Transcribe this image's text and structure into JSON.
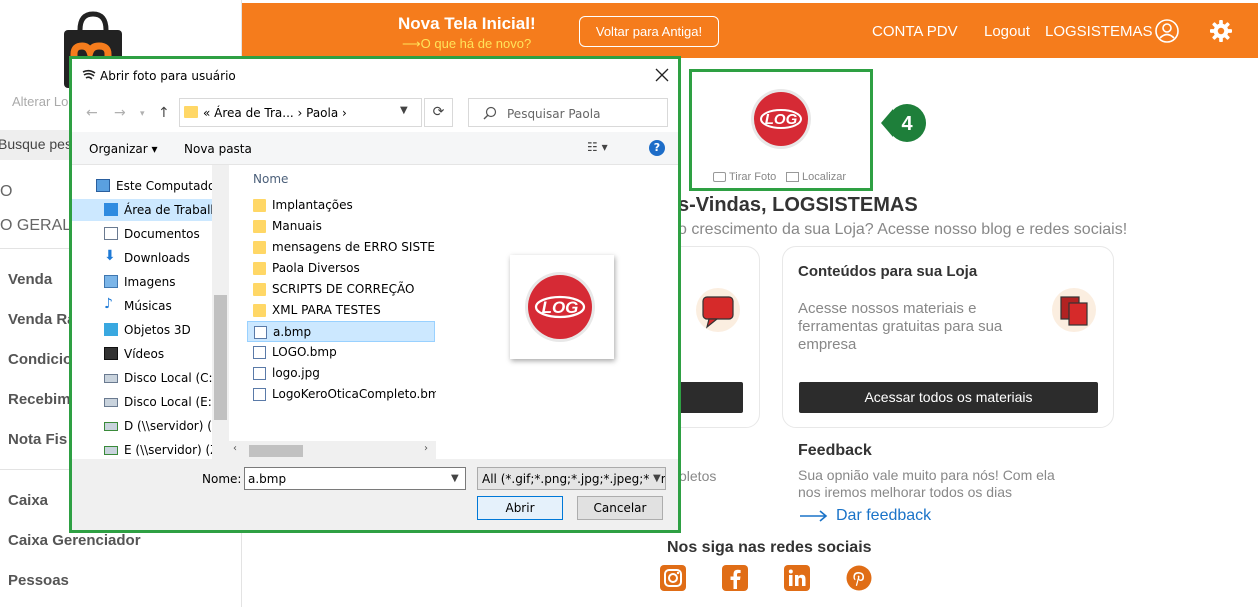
{
  "sidebar": {
    "link": "Alterar Lo",
    "search": "Busque pes",
    "plain_top": "O",
    "plain_geral": "O GERAL",
    "items": [
      "Venda",
      "Venda Ra",
      "Condicio",
      "Recebim",
      "Nota Fis",
      "Caixa",
      "Caixa Gerenciador",
      "Pessoas"
    ]
  },
  "topbar": {
    "title": "Nova Tela Inicial!",
    "subtitle": "⟶O que há de novo?",
    "back_button": "Voltar para Antiga!",
    "conta_pdv": "CONTA PDV",
    "logout": "Logout",
    "user": "LOGSISTEMAS",
    "accent": "#f57c1c"
  },
  "photo_box": {
    "take_photo": "Tirar Foto",
    "locate": "Localizar",
    "badge": "4",
    "logo_text": "LOG"
  },
  "welcome": {
    "title": "s-Vindas, LOGSISTEMAS",
    "subtitle": "o crescimento da sua Loja? Acesse nosso blog e redes sociais!"
  },
  "content_card": {
    "title": "Conteúdos para sua Loja",
    "text": "Acesse nossos materiais e ferramentas gratuitas para sua empresa",
    "button": "Acessar todos os materiais"
  },
  "boletos": "oletos",
  "feedback": {
    "title": "Feedback",
    "text": "Sua opnião vale muito para nós! Com ela nos iremos melhorar todos os dias",
    "link": "Dar feedback"
  },
  "social": {
    "title": "Nos siga nas redes sociais",
    "icons": [
      "instagram-icon",
      "facebook-icon",
      "linkedin-icon",
      "pinterest-icon"
    ]
  },
  "dialog": {
    "title": "Abrir foto para usuário",
    "address": "«  Área de Tra...  ›  Paola  ›",
    "search_placeholder": "Pesquisar Paola",
    "organize": "Organizar ▾",
    "new_folder": "Nova pasta",
    "help": "?",
    "tree": [
      {
        "label": "Este Computador",
        "icon": "computer-icon"
      },
      {
        "label": "Área de Trabalho",
        "icon": "desktop-icon",
        "selected": true
      },
      {
        "label": "Documentos",
        "icon": "documents-icon"
      },
      {
        "label": "Downloads",
        "icon": "downloads-icon"
      },
      {
        "label": "Imagens",
        "icon": "pictures-icon"
      },
      {
        "label": "Músicas",
        "icon": "music-icon"
      },
      {
        "label": "Objetos 3D",
        "icon": "objects3d-icon"
      },
      {
        "label": "Vídeos",
        "icon": "videos-icon"
      },
      {
        "label": "Disco Local (C:)",
        "icon": "drive-icon"
      },
      {
        "label": "Disco Local (E:)",
        "icon": "drive-icon"
      },
      {
        "label": "D (\\\\servidor) (Y:)",
        "icon": "network-drive-icon"
      },
      {
        "label": "E (\\\\servidor) (Z:)",
        "icon": "network-drive-icon"
      }
    ],
    "column_name": "Nome",
    "files": [
      {
        "label": "Implantações",
        "type": "folder"
      },
      {
        "label": "Manuais",
        "type": "folder"
      },
      {
        "label": "mensagens de ERRO SISTEMA",
        "type": "folder"
      },
      {
        "label": "Paola Diversos",
        "type": "folder"
      },
      {
        "label": "SCRIPTS DE CORREÇÃO",
        "type": "folder"
      },
      {
        "label": "XML PARA TESTES",
        "type": "folder"
      },
      {
        "label": "a.bmp",
        "type": "bmp",
        "selected": true
      },
      {
        "label": "LOGO.bmp",
        "type": "bmp"
      },
      {
        "label": "logo.jpg",
        "type": "bmp"
      },
      {
        "label": "LogoKeroOticaCompleto.bmp",
        "type": "bmp"
      }
    ],
    "name_label": "Nome:",
    "name_value": "a.bmp",
    "file_type": "All (*.gif;*.png;*.jpg;*.jpeg;*.bmp)",
    "open_button": "Abrir",
    "cancel_button": "Cancelar"
  }
}
